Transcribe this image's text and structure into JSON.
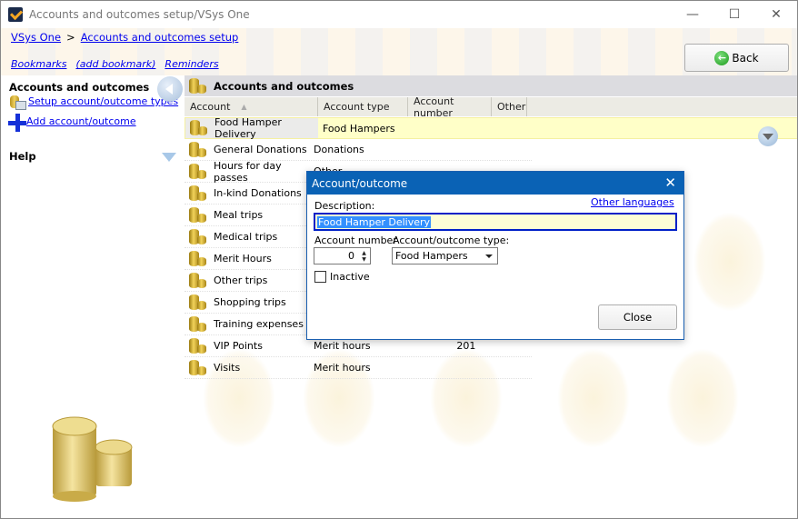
{
  "window": {
    "title": "Accounts and outcomes setup/VSys One",
    "controls": {
      "minimize": "—",
      "maximize": "☐",
      "close": "✕"
    }
  },
  "breadcrumb": {
    "items": [
      "VSys One",
      "Accounts and outcomes setup"
    ],
    "separator": ">"
  },
  "bookmarks": {
    "bookmarks": "Bookmarks",
    "add_bookmark": "(add bookmark)",
    "reminders": "Reminders"
  },
  "toolbar": {
    "back_label": "Back"
  },
  "sidebar": {
    "section_title": "Accounts and outcomes",
    "setup_types": "Setup account/outcome types",
    "add_account": "Add account/outcome",
    "help": "Help"
  },
  "panel": {
    "title": "Accounts and outcomes",
    "columns": [
      "Account",
      "Account type",
      "Account number",
      "Other"
    ],
    "sort_indicator": "▲",
    "rows": [
      {
        "account": "Food Hamper Delivery",
        "type": "Food Hampers",
        "number": "",
        "selected": true
      },
      {
        "account": "General Donations",
        "type": "Donations",
        "number": ""
      },
      {
        "account": "Hours for day passes",
        "type": "Other",
        "number": ""
      },
      {
        "account": "In-kind Donations",
        "type": "",
        "number": ""
      },
      {
        "account": "Meal trips",
        "type": "",
        "number": ""
      },
      {
        "account": "Medical trips",
        "type": "",
        "number": ""
      },
      {
        "account": "Merit Hours",
        "type": "",
        "number": ""
      },
      {
        "account": "Other trips",
        "type": "",
        "number": ""
      },
      {
        "account": "Shopping trips",
        "type": "",
        "number": ""
      },
      {
        "account": "Training expenses",
        "type": "",
        "number": ""
      },
      {
        "account": "VIP Points",
        "type": "Merit hours",
        "number": "201"
      },
      {
        "account": "Visits",
        "type": "Merit hours",
        "number": ""
      }
    ]
  },
  "dialog": {
    "title": "Account/outcome",
    "close_icon": "✕",
    "other_languages": "Other languages",
    "description_label": "Description:",
    "description_value": "Food Hamper Delivery",
    "account_number_label": "Account number",
    "account_number_value": "0",
    "type_label": "Account/outcome type:",
    "type_value": "Food Hampers",
    "inactive_label": "Inactive",
    "inactive_checked": false,
    "close_button": "Close"
  }
}
